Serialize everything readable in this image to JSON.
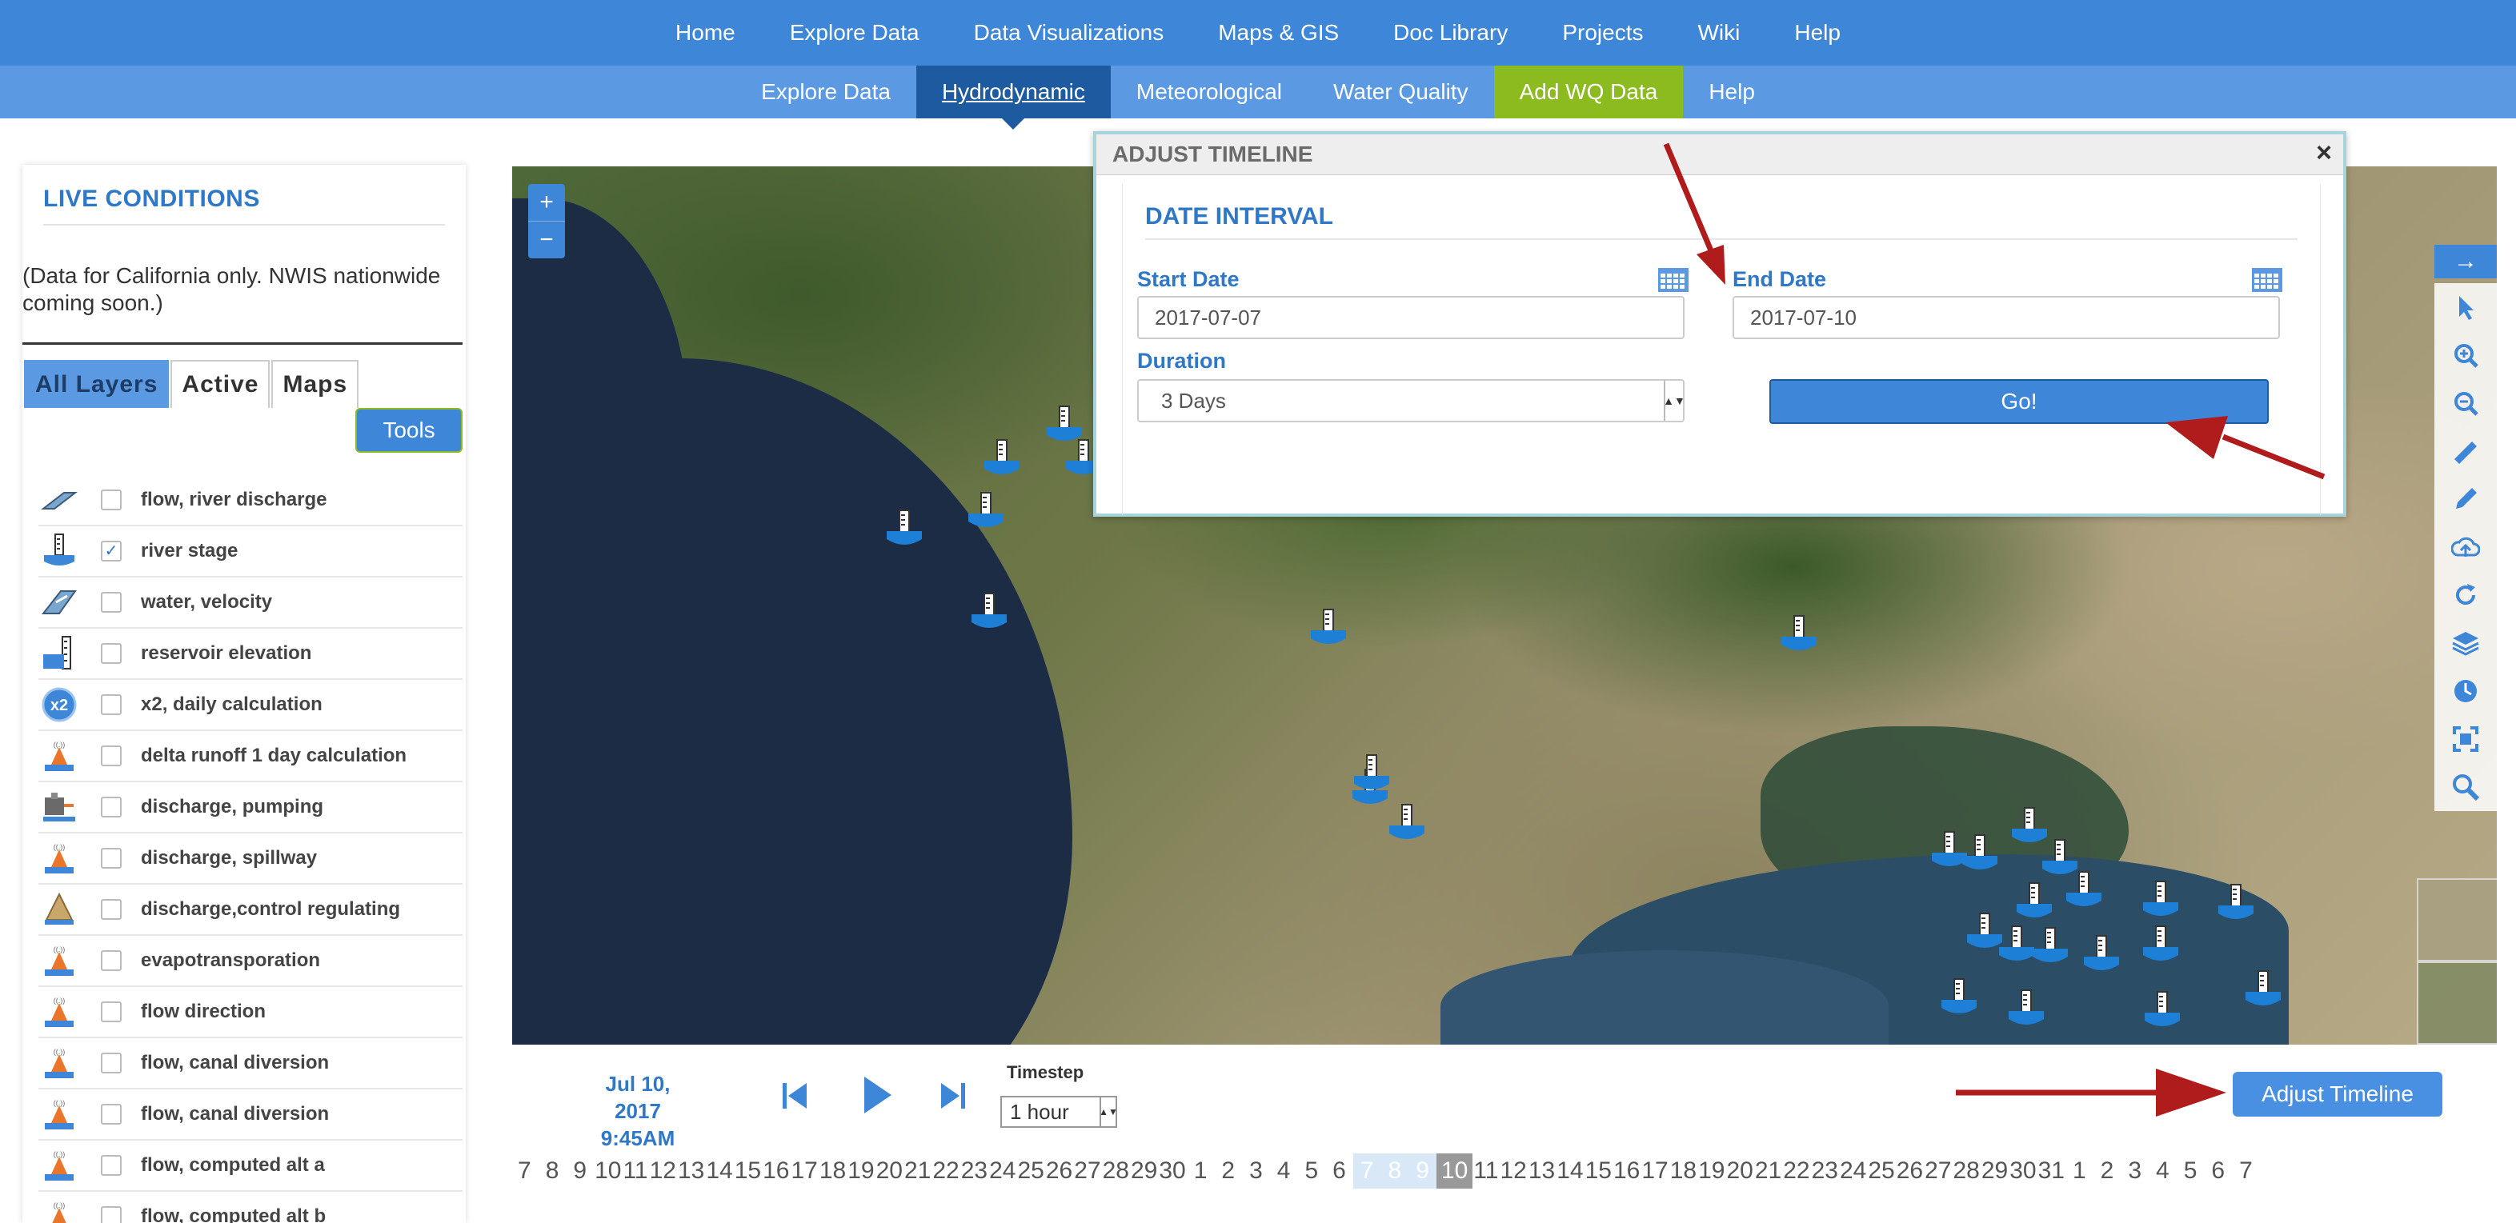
{
  "top_nav": [
    "Home",
    "Explore Data",
    "Data Visualizations",
    "Maps & GIS",
    "Doc Library",
    "Projects",
    "Wiki",
    "Help"
  ],
  "sub_nav": [
    {
      "label": "Explore Data",
      "state": "normal"
    },
    {
      "label": "Hydrodynamic",
      "state": "active"
    },
    {
      "label": "Meteorological",
      "state": "normal"
    },
    {
      "label": "Water Quality",
      "state": "normal"
    },
    {
      "label": "Add WQ Data",
      "state": "highlight"
    },
    {
      "label": "Help",
      "state": "normal"
    }
  ],
  "sidebar": {
    "title": "LIVE CONDITIONS",
    "note": "(Data for California only. NWIS nationwide coming soon.)",
    "tabs": [
      "All Layers",
      "Active",
      "Maps"
    ],
    "active_tab": "All Layers",
    "tools_label": "Tools",
    "layers": [
      {
        "label": "flow, river discharge",
        "checked": false,
        "icon": "river-discharge-icon"
      },
      {
        "label": "river stage",
        "checked": true,
        "icon": "river-stage-icon"
      },
      {
        "label": "water, velocity",
        "checked": false,
        "icon": "water-velocity-icon"
      },
      {
        "label": "reservoir elevation",
        "checked": false,
        "icon": "reservoir-elevation-icon"
      },
      {
        "label": "x2, daily calculation",
        "checked": false,
        "icon": "x2-icon"
      },
      {
        "label": "delta runoff 1 day calculation",
        "checked": false,
        "icon": "cone-icon"
      },
      {
        "label": "discharge, pumping",
        "checked": false,
        "icon": "pumping-icon"
      },
      {
        "label": "discharge, spillway",
        "checked": false,
        "icon": "cone-icon"
      },
      {
        "label": "discharge,control regulating",
        "checked": false,
        "icon": "control-regulating-icon"
      },
      {
        "label": "evapotransporation",
        "checked": false,
        "icon": "cone-icon"
      },
      {
        "label": "flow direction",
        "checked": false,
        "icon": "cone-icon"
      },
      {
        "label": "flow, canal diversion",
        "checked": false,
        "icon": "cone-icon"
      },
      {
        "label": "flow, canal diversion",
        "checked": false,
        "icon": "cone-icon"
      },
      {
        "label": "flow, computed alt a",
        "checked": false,
        "icon": "cone-icon"
      },
      {
        "label": "flow, computed alt b",
        "checked": false,
        "icon": "cone-icon"
      }
    ]
  },
  "map": {
    "zoom_in": "+",
    "zoom_out": "−",
    "toolbar_icons": [
      "arrow-right-icon",
      "pointer-icon",
      "zoom-in-icon",
      "zoom-out-icon",
      "ruler-icon",
      "pencil-icon",
      "cloud-upload-icon",
      "refresh-icon",
      "layers-icon",
      "clock-icon",
      "fullscreen-icon",
      "search-icon"
    ],
    "marker_count": 28
  },
  "dialog": {
    "title": "ADJUST TIMELINE",
    "close": "×",
    "section": "DATE INTERVAL",
    "start_label": "Start Date",
    "start_value": "2017-07-07",
    "end_label": "End Date",
    "end_value": "2017-07-10",
    "duration_label": "Duration",
    "duration_value": "3 Days",
    "go_label": "Go!"
  },
  "timeline": {
    "date": "Jul 10, 2017",
    "time": "9:45AM",
    "timestep_label": "Timestep",
    "timestep_value": "1 hour",
    "adjust_label": "Adjust Timeline",
    "days": [
      "7",
      "8",
      "9",
      "10",
      "11",
      "12",
      "13",
      "14",
      "15",
      "16",
      "17",
      "18",
      "19",
      "20",
      "21",
      "22",
      "23",
      "24",
      "25",
      "26",
      "27",
      "28",
      "29",
      "30",
      "1",
      "2",
      "3",
      "4",
      "5",
      "6",
      "7",
      "8",
      "9",
      "10",
      "11",
      "12",
      "13",
      "14",
      "15",
      "16",
      "17",
      "18",
      "19",
      "20",
      "21",
      "22",
      "23",
      "24",
      "25",
      "26",
      "27",
      "28",
      "29",
      "30",
      "31",
      "1",
      "2",
      "3",
      "4",
      "5",
      "6",
      "7"
    ],
    "highlight_light": [
      30,
      31,
      32
    ],
    "highlight_dark": 33
  },
  "colors": {
    "nav": "#3d86d8",
    "subnav": "#5b9ae2",
    "active_tab": "#1d5aa0",
    "highlight_tab": "#8bbb1e",
    "annotation_arrow": "#b01c1c"
  }
}
